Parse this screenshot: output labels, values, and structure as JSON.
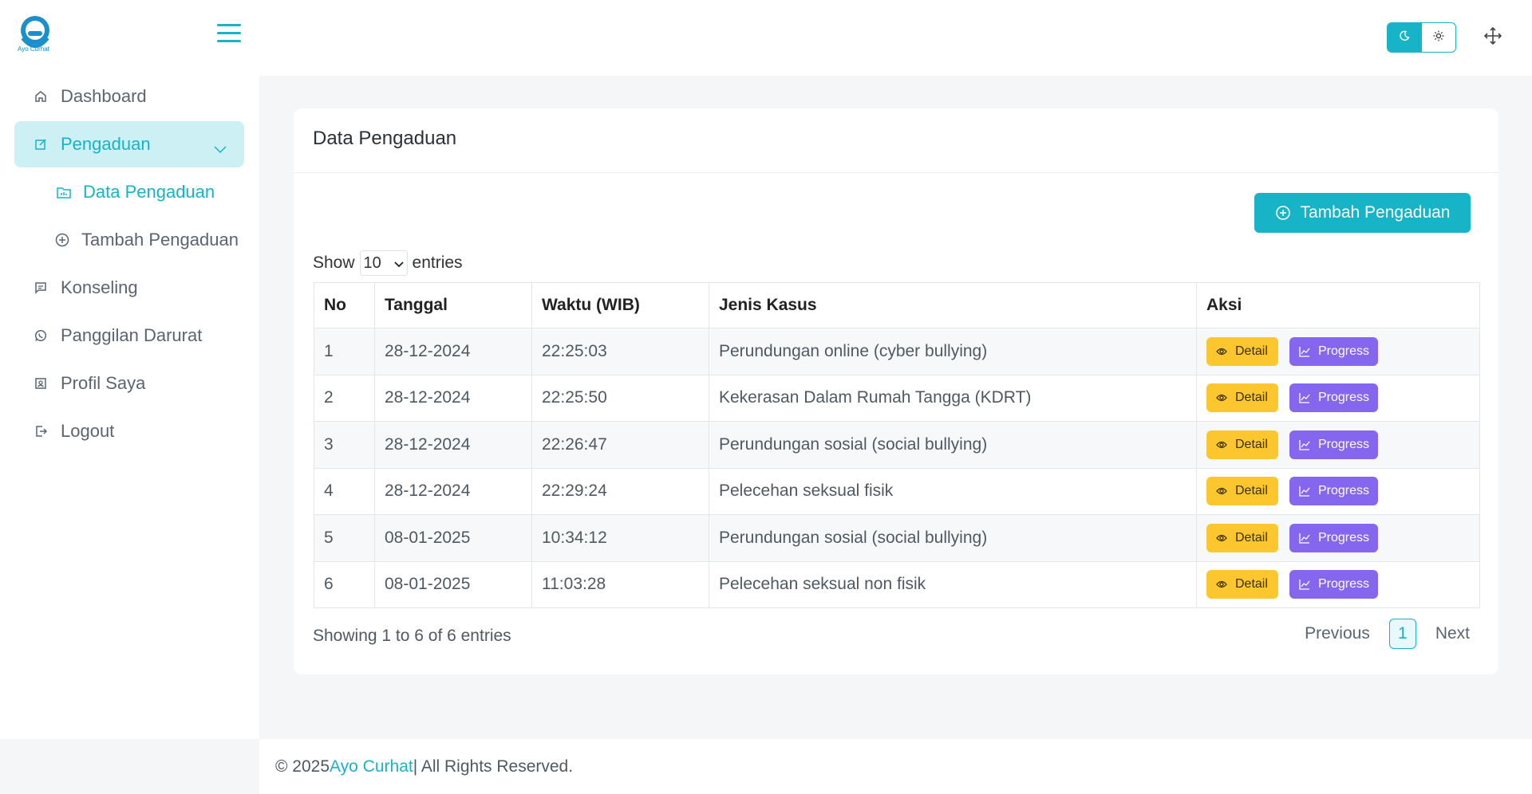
{
  "app": {
    "brand_name": "Ayo Curhat",
    "accent_color": "#17b3c6"
  },
  "sidebar": {
    "items": [
      {
        "label": "Dashboard",
        "icon": "home-icon"
      },
      {
        "label": "Pengaduan",
        "icon": "edit-square-icon"
      },
      {
        "label": "Konseling",
        "icon": "message-square-icon"
      },
      {
        "label": "Panggilan Darurat",
        "icon": "whatsapp-icon"
      },
      {
        "label": "Profil Saya",
        "icon": "profile-card-icon"
      },
      {
        "label": "Logout",
        "icon": "logout-icon"
      }
    ],
    "subitems": [
      {
        "label": "Data Pengaduan",
        "icon": "folder-chart-icon"
      },
      {
        "label": "Tambah Pengaduan",
        "icon": "plus-circle-icon"
      }
    ]
  },
  "card": {
    "title": "Data Pengaduan",
    "add_button": "Tambah Pengaduan",
    "show_label": "Show",
    "entries_label": "entries",
    "page_size": "10",
    "info": "Showing 1 to 6 of 6 entries"
  },
  "table": {
    "headers": [
      "No",
      "Tanggal",
      "Waktu (WIB)",
      "Jenis Kasus",
      "Aksi"
    ],
    "rows": [
      {
        "no": "1",
        "tanggal": "28-12-2024",
        "waktu": "22:25:03",
        "jenis": "Perundungan online (cyber bullying)"
      },
      {
        "no": "2",
        "tanggal": "28-12-2024",
        "waktu": "22:25:50",
        "jenis": "Kekerasan Dalam Rumah Tangga (KDRT)"
      },
      {
        "no": "3",
        "tanggal": "28-12-2024",
        "waktu": "22:26:47",
        "jenis": "Perundungan sosial (social bullying)"
      },
      {
        "no": "4",
        "tanggal": "28-12-2024",
        "waktu": "22:29:24",
        "jenis": "Pelecehan seksual fisik"
      },
      {
        "no": "5",
        "tanggal": "08-01-2025",
        "waktu": "10:34:12",
        "jenis": "Perundungan sosial (social bullying)"
      },
      {
        "no": "6",
        "tanggal": "08-01-2025",
        "waktu": "11:03:28",
        "jenis": "Pelecehan seksual non fisik"
      }
    ],
    "detail_label": "Detail",
    "progress_label": "Progress"
  },
  "pagination": {
    "previous": "Previous",
    "current": "1",
    "next": "Next"
  },
  "footer": {
    "prefix": "© 2025",
    "link": "Ayo Curhat",
    "suffix": "| All Rights Reserved."
  }
}
